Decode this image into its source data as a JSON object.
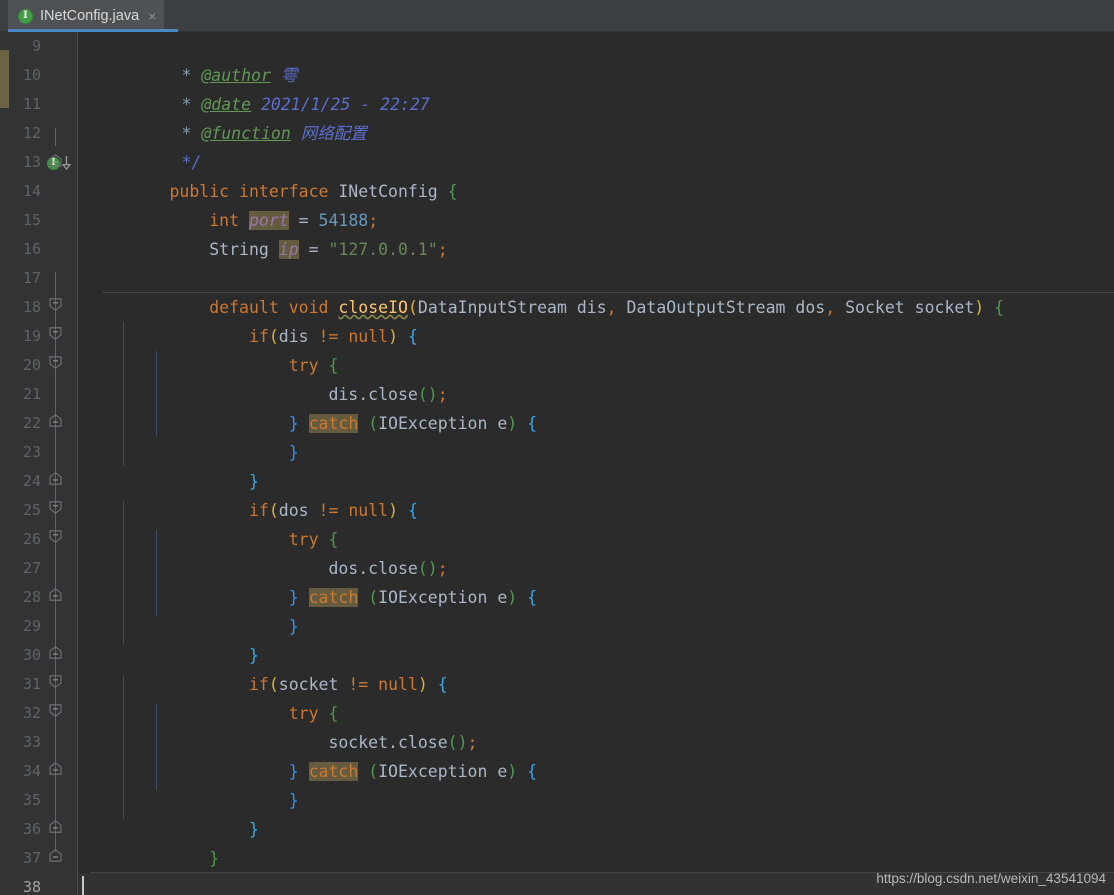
{
  "window": {
    "app": "IntelliJ IDEA editor",
    "theme_colors": {
      "editor_background": "#2b2b2b",
      "gutter_background": "#313335",
      "tabbar_background": "#3c3f41",
      "active_tab_background": "#4e5254",
      "active_tab_underline": "#4a88c7",
      "current_line_background": "#323232",
      "keyword": "#cc7832",
      "field": "#9876aa",
      "number": "#6897bb",
      "string": "#6a8759",
      "method": "#ffc66d",
      "comment_tag": "#629755",
      "comment_value": "#5a6fd0",
      "identifier_highlight": "#655c3f",
      "vcs_change_marker": "#6c6345"
    }
  },
  "tabbar": {
    "tabs": [
      {
        "label": "INetConfig.java",
        "icon": "java-interface-icon",
        "icon_letter": "I",
        "close_label": "×",
        "active": true
      }
    ]
  },
  "gutter": {
    "first_line": 9,
    "last_line": 38,
    "current_line": 38,
    "line_numbers": [
      9,
      10,
      11,
      12,
      13,
      14,
      15,
      16,
      17,
      18,
      19,
      20,
      21,
      22,
      23,
      24,
      25,
      26,
      27,
      28,
      29,
      30,
      31,
      32,
      33,
      34,
      35,
      36,
      37,
      38
    ],
    "implemented_marker": {
      "line": 13,
      "letter": "I",
      "tooltip": "Implemented in subclasses"
    },
    "fold_regions": [
      {
        "start": 12,
        "end": 12,
        "type": "end"
      },
      {
        "start": 17,
        "end": 36,
        "type": "start"
      },
      {
        "start": 18,
        "end": 23,
        "type": "start"
      },
      {
        "start": 19,
        "end": 21,
        "type": "start"
      },
      {
        "start": 24,
        "end": 29,
        "type": "start"
      },
      {
        "start": 25,
        "end": 27,
        "type": "start"
      },
      {
        "start": 30,
        "end": 35,
        "type": "start"
      },
      {
        "start": 31,
        "end": 33,
        "type": "start"
      }
    ]
  },
  "code": {
    "language": "Java",
    "file_name": "INetConfig.java",
    "lines": [
      {
        "n": 9,
        "text": " * @author 雩"
      },
      {
        "n": 10,
        "text": " * @date 2021/1/25 - 22:27"
      },
      {
        "n": 11,
        "text": " * @function 网络配置"
      },
      {
        "n": 12,
        "text": " */"
      },
      {
        "n": 13,
        "text": "public interface INetConfig {"
      },
      {
        "n": 14,
        "text": "    int port = 54188;"
      },
      {
        "n": 15,
        "text": "    String ip = \"127.0.0.1\";"
      },
      {
        "n": 16,
        "text": ""
      },
      {
        "n": 17,
        "text": "    default void closeIO(DataInputStream dis, DataOutputStream dos, Socket socket) {"
      },
      {
        "n": 18,
        "text": "        if(dis != null) {"
      },
      {
        "n": 19,
        "text": "            try {"
      },
      {
        "n": 20,
        "text": "                dis.close();"
      },
      {
        "n": 21,
        "text": "            } catch (IOException e) {"
      },
      {
        "n": 22,
        "text": "            }"
      },
      {
        "n": 23,
        "text": "        }"
      },
      {
        "n": 24,
        "text": "        if(dos != null) {"
      },
      {
        "n": 25,
        "text": "            try {"
      },
      {
        "n": 26,
        "text": "                dos.close();"
      },
      {
        "n": 27,
        "text": "            } catch (IOException e) {"
      },
      {
        "n": 28,
        "text": "            }"
      },
      {
        "n": 29,
        "text": "        }"
      },
      {
        "n": 30,
        "text": "        if(socket != null) {"
      },
      {
        "n": 31,
        "text": "            try {"
      },
      {
        "n": 32,
        "text": "                socket.close();"
      },
      {
        "n": 33,
        "text": "            } catch (IOException e) {"
      },
      {
        "n": 34,
        "text": "            }"
      },
      {
        "n": 35,
        "text": "        }"
      },
      {
        "n": 36,
        "text": "    }"
      },
      {
        "n": 37,
        "text": ""
      },
      {
        "n": 38,
        "text": ""
      }
    ],
    "javadoc": {
      "author_tag": "@author",
      "author_value": "雩",
      "date_tag": "@date",
      "date_value": "2021/1/25 - 22:27",
      "function_tag": "@function",
      "function_value": "网络配置",
      "close": "*/"
    },
    "fields": [
      {
        "type": "int",
        "name": "port",
        "value": "54188"
      },
      {
        "type": "String",
        "name": "ip",
        "value": "\"127.0.0.1\""
      }
    ],
    "interface_name": "INetConfig",
    "method": {
      "modifier": "default",
      "return_type": "void",
      "name": "closeIO",
      "params": [
        {
          "type": "DataInputStream",
          "name": "dis"
        },
        {
          "type": "DataOutputStream",
          "name": "dos"
        },
        {
          "type": "Socket",
          "name": "socket"
        }
      ],
      "exception": "IOException"
    }
  },
  "watermark": {
    "text": "https://blog.csdn.net/weixin_43541094"
  }
}
